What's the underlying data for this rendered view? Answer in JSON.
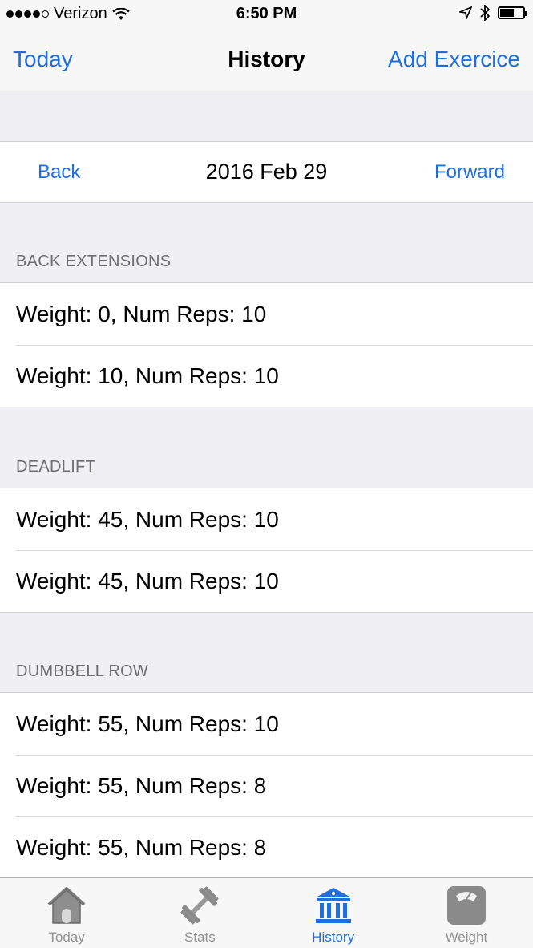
{
  "status_bar": {
    "carrier": "Verizon",
    "time": "6:50 PM"
  },
  "nav": {
    "left_label": "Today",
    "title": "History",
    "right_label": "Add Exercice"
  },
  "date_nav": {
    "back_label": "Back",
    "date": "2016 Feb 29",
    "forward_label": "Forward"
  },
  "sections": [
    {
      "header": "BACK EXTENSIONS",
      "rows": [
        "Weight: 0, Num Reps: 10",
        "Weight: 10, Num Reps: 10"
      ]
    },
    {
      "header": "DEADLIFT",
      "rows": [
        "Weight: 45, Num Reps: 10",
        "Weight: 45, Num Reps: 10"
      ]
    },
    {
      "header": "DUMBBELL ROW",
      "rows": [
        "Weight: 55, Num Reps: 10",
        "Weight: 55, Num Reps: 8",
        "Weight: 55, Num Reps: 8"
      ]
    }
  ],
  "tabs": [
    {
      "label": "Today",
      "icon": "house-icon"
    },
    {
      "label": "Stats",
      "icon": "dumbbell-icon"
    },
    {
      "label": "History",
      "icon": "bank-icon"
    },
    {
      "label": "Weight",
      "icon": "scale-icon"
    }
  ],
  "colors": {
    "accent": "#1f6fe0",
    "inactive_tab": "#929292",
    "background": "#efeff4"
  }
}
